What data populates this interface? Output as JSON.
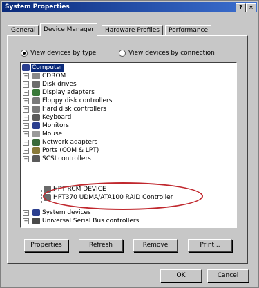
{
  "window": {
    "title": "System Properties",
    "help_icon": "?",
    "close_icon": "×"
  },
  "tabs": [
    {
      "label": "General",
      "active": false
    },
    {
      "label": "Device Manager",
      "active": true
    },
    {
      "label": "Hardware Profiles",
      "active": false
    },
    {
      "label": "Performance",
      "active": false
    }
  ],
  "view_options": {
    "by_type": {
      "label": "View devices by type",
      "checked": true
    },
    "by_connection": {
      "label": "View devices by connection",
      "checked": false
    }
  },
  "tree": {
    "root": {
      "label": "Computer",
      "icon": "computer-icon"
    },
    "items": [
      {
        "label": "CDROM",
        "icon": "cdrom-icon",
        "color": "#8a8a8a"
      },
      {
        "label": "Disk drives",
        "icon": "disk-icon",
        "color": "#6d6d6d"
      },
      {
        "label": "Display adapters",
        "icon": "display-icon",
        "color": "#3a7a3a"
      },
      {
        "label": "Floppy disk controllers",
        "icon": "floppy-icon",
        "color": "#7a7a7a"
      },
      {
        "label": "Hard disk controllers",
        "icon": "harddisk-icon",
        "color": "#7a7a7a"
      },
      {
        "label": "Keyboard",
        "icon": "keyboard-icon",
        "color": "#5a5a5a"
      },
      {
        "label": "Monitors",
        "icon": "monitor-icon",
        "color": "#2b3f8f"
      },
      {
        "label": "Mouse",
        "icon": "mouse-icon",
        "color": "#9a9a9a"
      },
      {
        "label": "Network adapters",
        "icon": "network-icon",
        "color": "#3a6a3a"
      },
      {
        "label": "Ports (COM & LPT)",
        "icon": "ports-icon",
        "color": "#8a7a3a"
      },
      {
        "label": "SCSI controllers",
        "icon": "scsi-icon",
        "color": "#5a5a5a",
        "expanded": true
      }
    ],
    "scsi_children": [
      {
        "label": "HPT RCM DEVICE",
        "icon": "device-icon",
        "color": "#6a6a6a"
      },
      {
        "label": "HPT370 UDMA/ATA100 RAID Controller",
        "icon": "controller-icon",
        "color": "#6a6a6a"
      }
    ],
    "after": [
      {
        "label": "System devices",
        "icon": "system-icon",
        "color": "#2b3f8f"
      },
      {
        "label": "Universal Serial Bus controllers",
        "icon": "usb-icon",
        "color": "#4a4a4a"
      }
    ],
    "highlight_color": "#c0272d"
  },
  "actions": {
    "properties": "Properties",
    "refresh": "Refresh",
    "remove": "Remove",
    "print": "Print..."
  },
  "dialog": {
    "ok": "OK",
    "cancel": "Cancel"
  }
}
